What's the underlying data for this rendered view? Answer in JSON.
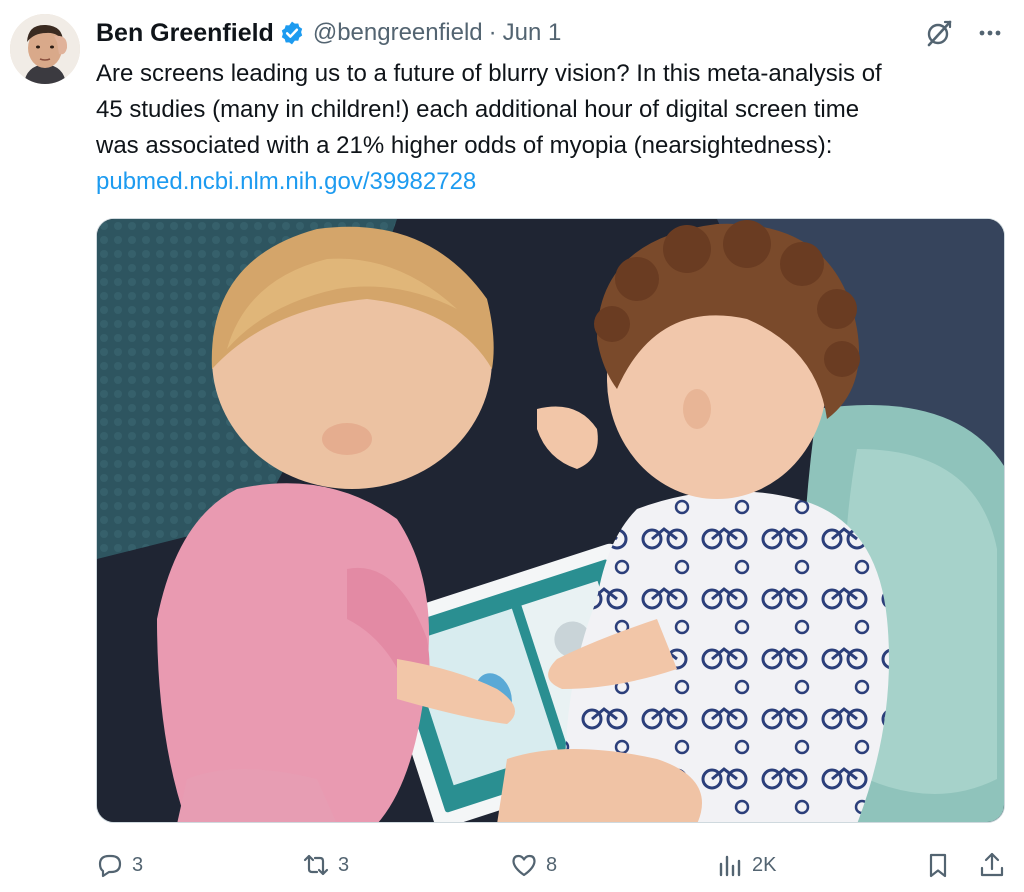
{
  "author": {
    "name": "Ben Greenfield",
    "handle": "@bengreenfield",
    "separator": "·",
    "date": "Jun 1",
    "verified_icon": "verified-badge-icon",
    "verified_color": "#1d9bf0"
  },
  "tweet": {
    "text_lines": [
      "Are screens leading us to a future of blurry vision? In this meta-analysis of",
      "45 studies (many in children!) each additional hour of digital screen time",
      "was associated with a 21% higher odds of myopia (nearsightedness):"
    ],
    "link": "pubmed.ncbi.nlm.nih.gov/39982728",
    "link_color": "#1d9bf0"
  },
  "media": {
    "icon": "photo-two-toddlers-using-tablet"
  },
  "header_icons": [
    "grok-icon",
    "more-options-icon"
  ],
  "actions": {
    "reply": {
      "icon": "reply-icon",
      "count": "3"
    },
    "retweet": {
      "icon": "retweet-icon",
      "count": "3"
    },
    "like": {
      "icon": "like-icon",
      "count": "8"
    },
    "views": {
      "icon": "views-icon",
      "count": "2K"
    },
    "bookmark": {
      "icon": "bookmark-icon"
    },
    "share": {
      "icon": "share-icon"
    }
  },
  "colors": {
    "text": "#0f1419",
    "secondary": "#536471",
    "accent": "#1d9bf0"
  }
}
